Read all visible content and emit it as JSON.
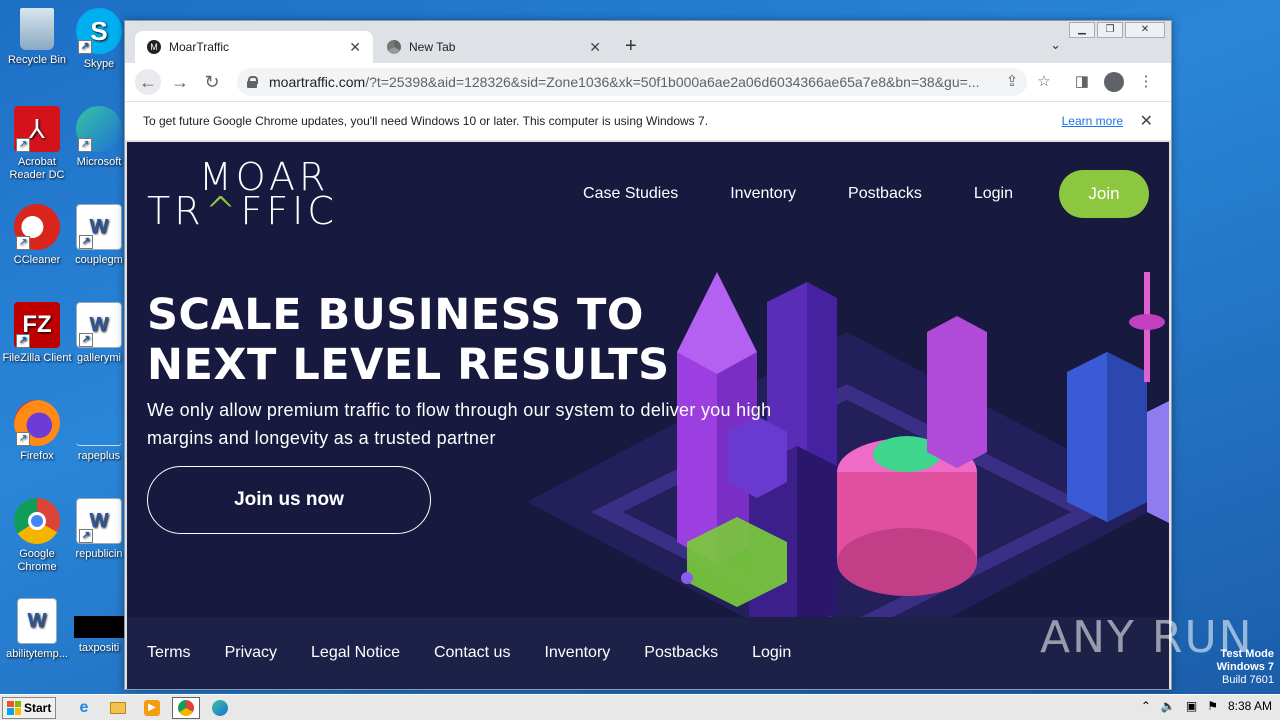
{
  "desktop": {
    "icons": [
      {
        "label": "Recycle Bin"
      },
      {
        "label": "Skype"
      },
      {
        "label": "Acrobat Reader DC"
      },
      {
        "label": "Microsoft"
      },
      {
        "label": "CCleaner"
      },
      {
        "label": "couplegm"
      },
      {
        "label": "FileZilla Client"
      },
      {
        "label": "gallerymi"
      },
      {
        "label": "Firefox"
      },
      {
        "label": "rapeplus"
      },
      {
        "label": "Google Chrome"
      },
      {
        "label": "republicin"
      },
      {
        "label": "abilitytemp..."
      },
      {
        "label": "taxpositi"
      }
    ]
  },
  "browser": {
    "tabs": [
      {
        "title": "MoarTraffic",
        "close": "✕"
      },
      {
        "title": "New Tab",
        "close": "✕"
      }
    ],
    "new_tab": "+",
    "tab_list": "⌄",
    "url_host": "moartraffic.com",
    "url_path": "/?t=25398&aid=128326&sid=Zone1036&xk=50f1b000a6ae2a06d6034366ae65a7e8&bn=38&gu=...",
    "infobar_text": "To get future Google Chrome updates, you'll need Windows 10 or later. This computer is using Windows 7.",
    "infobar_link": "Learn more",
    "infobar_close": "✕"
  },
  "site": {
    "logo_line1": "MOAR",
    "logo_line2_a": "TR",
    "logo_line2_caret": "^",
    "logo_line2_b": "FFIC",
    "nav": [
      "Case Studies",
      "Inventory",
      "Postbacks",
      "Login"
    ],
    "join_label": "Join",
    "hero_line1": "SCALE BUSINESS TO",
    "hero_line2": "NEXT LEVEL RESULTS",
    "hero_sub": "We only allow premium traffic to flow through our system to deliver you high margins and longevity as a trusted partner",
    "cta_label": "Join us now",
    "footer_links": [
      "Terms",
      "Privacy",
      "Legal Notice",
      "Contact us",
      "Inventory",
      "Postbacks",
      "Login"
    ],
    "accent": "#8dc63f",
    "background": "#17193f"
  },
  "watermark": {
    "brand": "ANY  RUN",
    "test_mode": "Test Mode",
    "os": "Windows 7",
    "build": "Build 7601"
  },
  "taskbar": {
    "start_label": "Start",
    "clock": "8:38 AM"
  }
}
